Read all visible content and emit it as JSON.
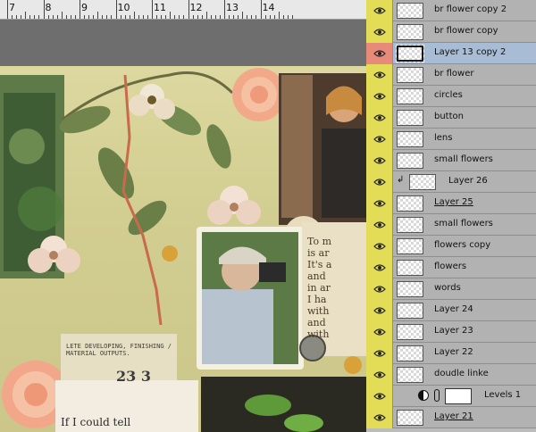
{
  "ruler": {
    "numbers": [
      "7",
      "8",
      "9",
      "10",
      "11",
      "12",
      "13",
      "14"
    ]
  },
  "canvas": {
    "journal_text": [
      "To m",
      "is ar",
      "It's a",
      "and",
      "in ar",
      "I ha",
      "with",
      "and",
      "with"
    ],
    "tag_text": "LETE DEVELOPING, FINISHING / MATERIAL OUTPUTS.",
    "tag_number": "23 3",
    "bottom_text": "If I could tell"
  },
  "layers": [
    {
      "name": "br flower copy 2"
    },
    {
      "name": "br flower copy"
    },
    {
      "name": "Layer 13 copy 2",
      "selected": true
    },
    {
      "name": "br flower"
    },
    {
      "name": "circles"
    },
    {
      "name": "button"
    },
    {
      "name": "lens"
    },
    {
      "name": "small flowers"
    },
    {
      "name": "Layer 26",
      "clipped": true
    },
    {
      "name": "Layer 25",
      "underline": true
    },
    {
      "name": "small flowers"
    },
    {
      "name": "flowers copy"
    },
    {
      "name": "flowers"
    },
    {
      "name": "words"
    },
    {
      "name": "Layer 24"
    },
    {
      "name": "Layer 23"
    },
    {
      "name": "Layer 22"
    },
    {
      "name": "doudle linke"
    },
    {
      "name": "Levels 1",
      "adjustment": true
    },
    {
      "name": "Layer 21",
      "underline": true
    }
  ],
  "colors": {
    "eye_bg": "#e2dc56",
    "eye_selected_bg": "#e88a7a",
    "selected_row": "#a8bcd6"
  }
}
